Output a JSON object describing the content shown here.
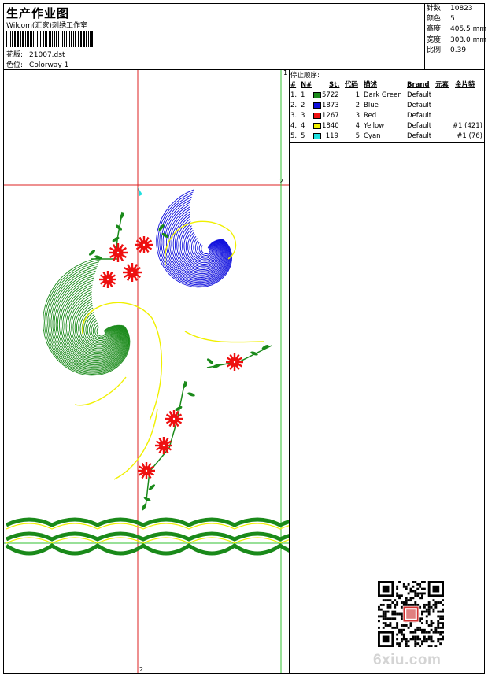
{
  "header": {
    "title": "生产作业图",
    "subtitle": "Wilcom(汇家)刺绣工作室",
    "design_label": "花版:",
    "design_value": "21007.dst",
    "colorway_label": "色位:",
    "colorway_value": "Colorway 1"
  },
  "stats": {
    "stitches_label": "针数:",
    "stitches_value": "10823",
    "colors_label": "颜色:",
    "colors_value": "5",
    "height_label": "高度:",
    "height_value": "405.5 mm",
    "width_label": "宽度:",
    "width_value": "303.0 mm",
    "ratio_label": "比例:",
    "ratio_value": "0.39"
  },
  "stop_sequence": {
    "caption": "停止顺序:",
    "headers": {
      "num": "#",
      "n": "N#",
      "st": "St.",
      "code": "代码",
      "desc": "描述",
      "brand": "Brand",
      "elem": "元素",
      "sequin": "金片特"
    },
    "rows": [
      {
        "num": "1.",
        "n": "1",
        "color": "#1a8a1a",
        "st": "5722",
        "code": "1",
        "desc": "Dark Green",
        "brand": "Default",
        "sequin": ""
      },
      {
        "num": "2.",
        "n": "2",
        "color": "#1010dd",
        "st": "1873",
        "code": "2",
        "desc": "Blue",
        "brand": "Default",
        "sequin": ""
      },
      {
        "num": "3.",
        "n": "3",
        "color": "#ee1010",
        "st": "1267",
        "code": "3",
        "desc": "Red",
        "brand": "Default",
        "sequin": ""
      },
      {
        "num": "4.",
        "n": "4",
        "color": "#f0f000",
        "st": "1840",
        "code": "4",
        "desc": "Yellow",
        "brand": "Default",
        "sequin": "#1 (421)"
      },
      {
        "num": "5.",
        "n": "5",
        "color": "#20e0e0",
        "st": "119",
        "code": "5",
        "desc": "Cyan",
        "brand": "Default",
        "sequin": "#1 (76)"
      }
    ]
  },
  "guides": {
    "vertical_label": "2",
    "horizontal_label": "2",
    "corner_label": "1"
  },
  "watermark": "6xiu.com",
  "colors": {
    "guide_red": "#dd2020",
    "guide_green": "#30c030"
  },
  "icons": {
    "qr": "qr-code-icon",
    "seal": "seal-stamp-icon"
  }
}
